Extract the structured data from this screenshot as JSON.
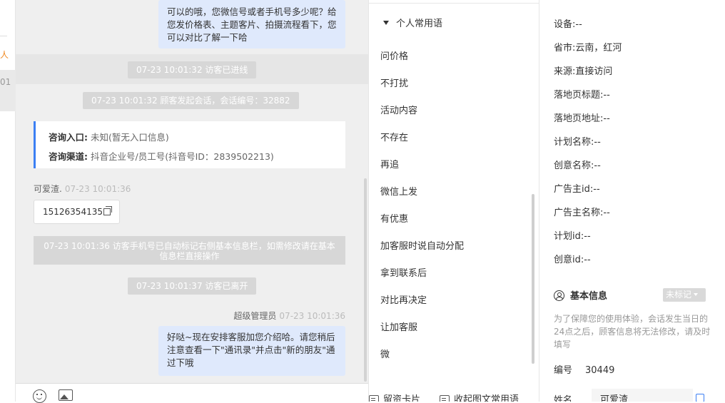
{
  "left_strip": {
    "item1": "人",
    "item2": "01"
  },
  "chat": {
    "messages_top": "可以的哦，您微信号或者手机号多少呢？给您发价格表、主题客片、拍摄流程看下，您可以对比了解一下哈",
    "sys_enter": "07-23 10:01:32 访客已进线",
    "sys_session": "07-23 10:01:32 顾客发起会话，会话编号：32882",
    "info": {
      "entry_label": "咨询入口:",
      "entry_value": "未知(暂无入口信息)",
      "channel_label": "咨询渠道:",
      "channel_value": "抖音企业号/员工号(抖音号ID：2839502213)"
    },
    "visitor_name": "可爱渣.",
    "visitor_time": "07-23 10:01:36",
    "visitor_phone": "15126354135",
    "sys_phone_mark": "07-23 10:01:36 访客手机号已自动标记右侧基本信息栏，如需修改请在基本信息栏直接操作",
    "sys_leave": "07-23 10:01:37 访客已离开",
    "agent_name": "超级管理员",
    "agent_time": "07-23 10:01:36",
    "agent_message": "好哒~现在安排客服加您介绍哈。请您稍后注意查看一下\"通讯录\"并点击\"新的朋友\"通过下哦"
  },
  "toolbar": {
    "emoji": "emoji-icon",
    "image": "image-icon"
  },
  "phrases": {
    "header": "个人常用语",
    "items": [
      "问价格",
      "不打扰",
      "活动内容",
      "不存在",
      "再追",
      "微信上发",
      "有优惠",
      "加客服时说自动分配",
      "拿到联系后",
      "对比再决定",
      "让加客服",
      "微"
    ],
    "bottom_left": "留资卡片",
    "bottom_right": "收起图文常用语"
  },
  "visitor_info": {
    "fields": [
      {
        "label": "设备:",
        "value": "--"
      },
      {
        "label": "省市:",
        "value": "云南，红河"
      },
      {
        "label": "来源:",
        "value": "直接访问"
      },
      {
        "label": "落地页标题:",
        "value": "--"
      },
      {
        "label": "落地页地址:",
        "value": "--"
      },
      {
        "label": "计划名称:",
        "value": "--"
      },
      {
        "label": "创意名称:",
        "value": "--"
      },
      {
        "label": "广告主id:",
        "value": "--"
      },
      {
        "label": "广告主名称:",
        "value": "--"
      },
      {
        "label": "计划id:",
        "value": "--"
      },
      {
        "label": "创意id:",
        "value": "--"
      }
    ],
    "basic_title": "基本信息",
    "tag_select": "未标记",
    "note": "为了保障您的使用体验，会话发生当日的24点之后，顾客信息将无法修改，请及时填写",
    "number_label": "编号",
    "number_value": "30449",
    "name_label": "姓名",
    "name_value": "可爱渣"
  }
}
